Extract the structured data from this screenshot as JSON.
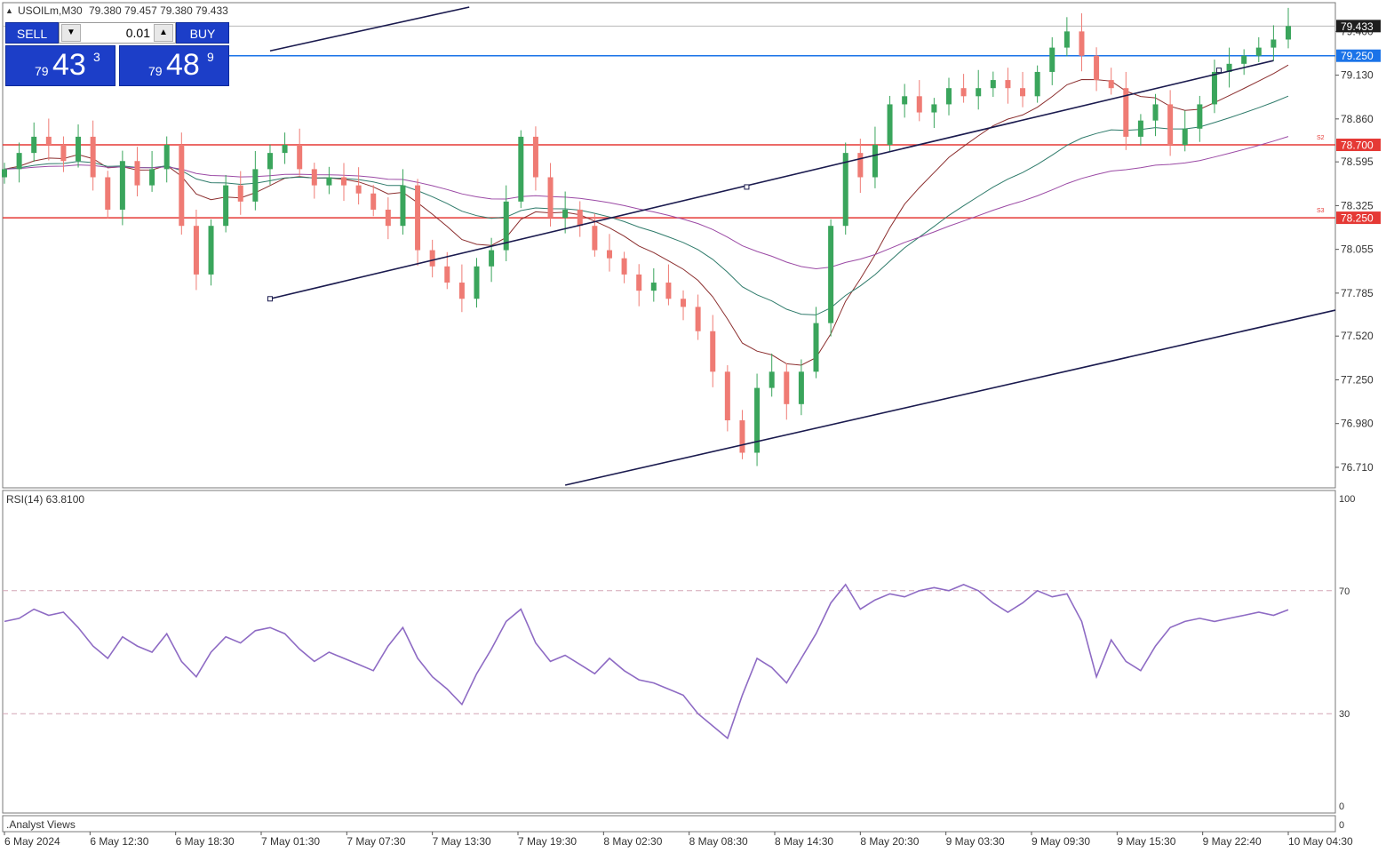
{
  "header": {
    "symbol": "USOILm,M30",
    "ohlc": "79.380 79.457 79.380 79.433"
  },
  "trade_panel": {
    "sell_label": "SELL",
    "buy_label": "BUY",
    "lot_value": "0.01",
    "sell_price": {
      "small": "79",
      "big": "43",
      "sup": "3"
    },
    "buy_price": {
      "small": "79",
      "big": "48",
      "sup": "9"
    }
  },
  "levels": {
    "current": {
      "value": "79.433",
      "color": "#d0d0d0"
    },
    "blue": {
      "value": "79.250",
      "color": "#1a73e8"
    },
    "s2": {
      "value": "78.700",
      "tag": "S2",
      "color": "#e53935"
    },
    "s3": {
      "value": "78.250",
      "tag": "S3",
      "color": "#e53935"
    }
  },
  "rsi_panel": {
    "label": "RSI(14) 63.8100",
    "axis": [
      "100",
      "70",
      "30",
      "0"
    ],
    "line_color": "#8e6bc4"
  },
  "bottom_panel": {
    "label": ".Analyst Views",
    "axis_label": "0"
  },
  "colors": {
    "bull": "#3aa55c",
    "bear": "#ef7b74",
    "ma_brown": "#8b2e2e",
    "ma_teal": "#2f7b6b",
    "ma_purple": "#9b4aa5",
    "channel": "#1a1a4e"
  },
  "chart_data": {
    "type": "candlestick",
    "timeframe": "M30",
    "ylim": [
      76.6,
      79.55
    ],
    "y_ticks": [
      "79.400",
      "79.130",
      "78.860",
      "78.595",
      "78.325",
      "78.055",
      "77.785",
      "77.520",
      "77.250",
      "76.980",
      "76.710"
    ],
    "x_ticks": [
      "6 May 2024",
      "6 May 12:30",
      "6 May 18:30",
      "7 May 01:30",
      "7 May 07:30",
      "7 May 13:30",
      "7 May 19:30",
      "8 May 02:30",
      "8 May 08:30",
      "8 May 14:30",
      "8 May 20:30",
      "9 May 03:30",
      "9 May 09:30",
      "9 May 15:30",
      "9 May 22:40",
      "10 May 04:30"
    ],
    "close_path": [
      78.55,
      78.65,
      78.75,
      78.7,
      78.6,
      78.75,
      78.5,
      78.3,
      78.6,
      78.45,
      78.55,
      78.7,
      78.2,
      77.9,
      78.2,
      78.45,
      78.35,
      78.55,
      78.65,
      78.7,
      78.55,
      78.45,
      78.5,
      78.45,
      78.4,
      78.3,
      78.2,
      78.45,
      78.05,
      77.95,
      77.85,
      77.75,
      77.95,
      78.05,
      78.35,
      78.75,
      78.5,
      78.25,
      78.3,
      78.2,
      78.05,
      78.0,
      77.9,
      77.8,
      77.85,
      77.75,
      77.7,
      77.55,
      77.3,
      77.0,
      76.8,
      77.2,
      77.3,
      77.1,
      77.3,
      77.6,
      78.2,
      78.65,
      78.5,
      78.7,
      78.95,
      79.0,
      78.9,
      78.95,
      79.05,
      79.0,
      79.05,
      79.1,
      79.05,
      79.0,
      79.15,
      79.3,
      79.4,
      79.25,
      79.1,
      79.05,
      78.75,
      78.85,
      78.95,
      78.7,
      78.8,
      78.95,
      79.15,
      79.2,
      79.25,
      79.3,
      79.35,
      79.433
    ],
    "rsi": [
      60,
      61,
      64,
      62,
      63,
      58,
      52,
      48,
      55,
      52,
      50,
      56,
      47,
      42,
      50,
      55,
      53,
      57,
      58,
      56,
      51,
      47,
      50,
      48,
      46,
      44,
      52,
      58,
      48,
      42,
      38,
      33,
      43,
      51,
      60,
      64,
      53,
      47,
      49,
      46,
      43,
      48,
      44,
      41,
      40,
      38,
      36,
      30,
      26,
      22,
      36,
      48,
      45,
      40,
      48,
      56,
      66,
      72,
      64,
      67,
      69,
      68,
      70,
      71,
      70,
      72,
      70,
      66,
      63,
      66,
      70,
      68,
      69,
      60,
      42,
      54,
      47,
      44,
      52,
      58,
      60,
      61,
      60,
      61,
      62,
      63,
      62,
      63.81
    ],
    "rsi_levels": [
      70,
      30
    ],
    "levels": [
      79.433,
      79.25,
      78.7,
      78.25
    ]
  }
}
